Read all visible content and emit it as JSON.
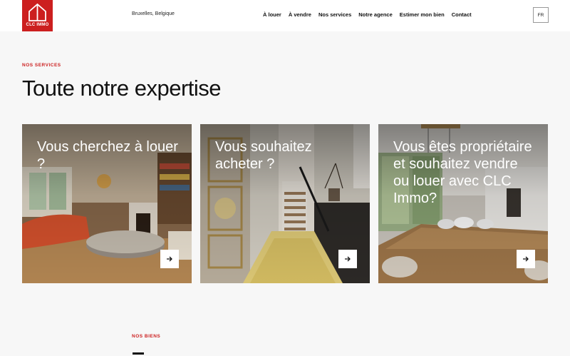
{
  "header": {
    "logo_text": "CLC IMMO",
    "location": "Bruxelles, Belgique",
    "nav": [
      "À louer",
      "À vendre",
      "Nos services",
      "Notre agence",
      "Estimer mon bien",
      "Contact"
    ],
    "language": "FR"
  },
  "services": {
    "eyebrow": "NOS SERVICES",
    "title": "Toute notre expertise",
    "cards": [
      {
        "title": "Vous cherchez à louer ?",
        "icon": "arrow-right-icon"
      },
      {
        "title": "Vous souhaitez acheter ?",
        "icon": "arrow-right-icon"
      },
      {
        "title": "Vous êtes propriétaire et souhaitez vendre ou louer avec CLC Immo?",
        "icon": "arrow-right-icon"
      }
    ]
  },
  "properties": {
    "eyebrow": "NOS BIENS"
  },
  "colors": {
    "accent": "#cc1f1f",
    "background": "#f7f7f7"
  }
}
